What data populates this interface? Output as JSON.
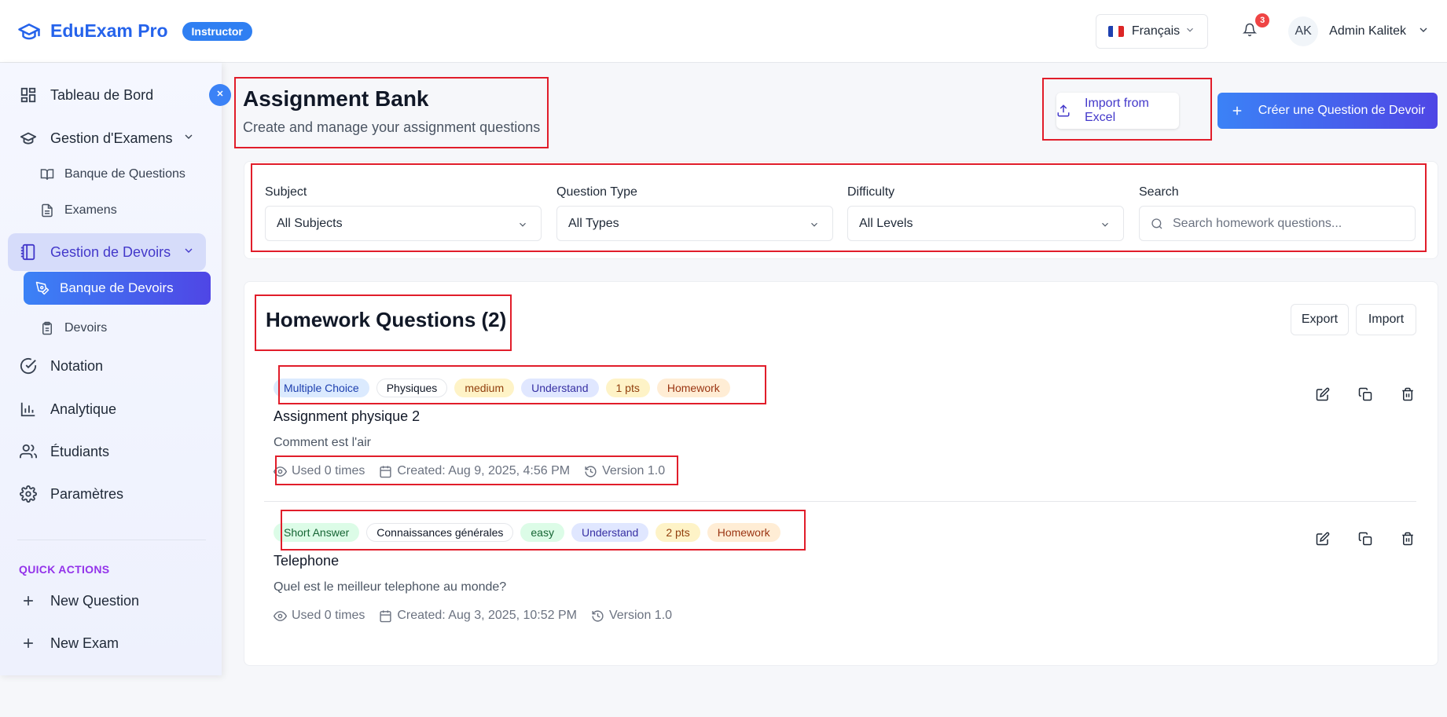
{
  "app": {
    "name": "EduExam Pro",
    "role": "Instructor",
    "language": "Français",
    "notifications": "3",
    "user_initials": "AK",
    "user_name": "Admin Kalitek",
    "accent_color": "#2563eb"
  },
  "sidebar": {
    "items": [
      {
        "label": "Tableau de Bord",
        "icon": "dashboard-icon"
      },
      {
        "label": "Gestion d'Examens",
        "icon": "graduation-cap-icon"
      },
      {
        "label": "Banque de Questions",
        "icon": "book-open-icon"
      },
      {
        "label": "Examens",
        "icon": "file-text-icon"
      },
      {
        "label": "Gestion de Devoirs",
        "icon": "notebook-icon"
      },
      {
        "label": "Banque de Devoirs",
        "icon": "pen-tool-icon"
      },
      {
        "label": "Devoirs",
        "icon": "clipboard-icon"
      },
      {
        "label": "Notation",
        "icon": "check-circle-icon"
      },
      {
        "label": "Analytique",
        "icon": "bar-chart-icon"
      },
      {
        "label": "Étudiants",
        "icon": "users-icon"
      },
      {
        "label": "Paramètres",
        "icon": "settings-icon"
      }
    ],
    "quick_actions_title": "QUICK ACTIONS",
    "quick_actions": [
      {
        "label": "New Question",
        "icon": "plus-icon"
      },
      {
        "label": "New Exam",
        "icon": "plus-icon"
      }
    ]
  },
  "header": {
    "title": "Assignment Bank",
    "subtitle": "Create and manage your assignment questions",
    "import_label": "Import from Excel",
    "create_label": "Créer une Question de Devoir"
  },
  "filters": {
    "subject": {
      "label": "Subject",
      "value": "All Subjects"
    },
    "type": {
      "label": "Question Type",
      "value": "All Types"
    },
    "difficulty": {
      "label": "Difficulty",
      "value": "All Levels"
    },
    "search": {
      "label": "Search",
      "placeholder": "Search homework questions..."
    }
  },
  "list": {
    "title": "Homework Questions (2)",
    "export_label": "Export",
    "import_label": "Import",
    "questions": [
      {
        "tags": [
          "Multiple Choice",
          "Physiques",
          "medium",
          "Understand",
          "1 pts",
          "Homework"
        ],
        "title": "Assignment physique 2",
        "description": "Comment est l'air",
        "used": "Used 0 times",
        "created": "Created: Aug 9, 2025, 4:56 PM",
        "version": "Version 1.0"
      },
      {
        "tags": [
          "Short Answer",
          "Connaissances générales",
          "easy",
          "Understand",
          "2 pts",
          "Homework"
        ],
        "title": "Telephone",
        "description": "Quel est le meilleur telephone au monde?",
        "used": "Used 0 times",
        "created": "Created: Aug 3, 2025, 10:52 PM",
        "version": "Version 1.0"
      }
    ]
  }
}
